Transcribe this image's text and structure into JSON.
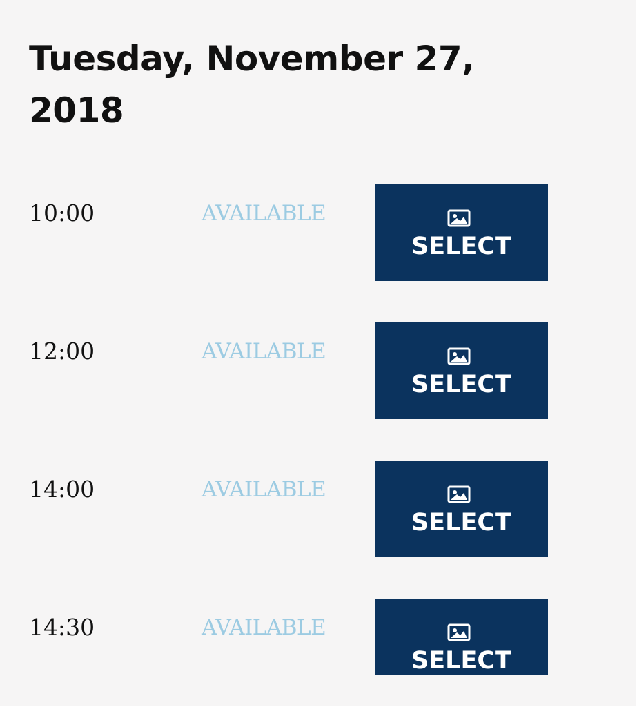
{
  "date_heading": "Tuesday, November 27, 2018",
  "colors": {
    "background": "#f6f5f5",
    "status_available": "#9ccbe2",
    "button_bg": "#0b335e",
    "button_text": "#ffffff"
  },
  "slots": [
    {
      "time": "10:00",
      "status": "AVAILABLE",
      "button_label": "SELECT",
      "button_icon": "image-icon"
    },
    {
      "time": "12:00",
      "status": "AVAILABLE",
      "button_label": "SELECT",
      "button_icon": "image-icon"
    },
    {
      "time": "14:00",
      "status": "AVAILABLE",
      "button_label": "SELECT",
      "button_icon": "image-icon"
    },
    {
      "time": "14:30",
      "status": "AVAILABLE",
      "button_label": "SELECT",
      "button_icon": "image-icon"
    }
  ]
}
